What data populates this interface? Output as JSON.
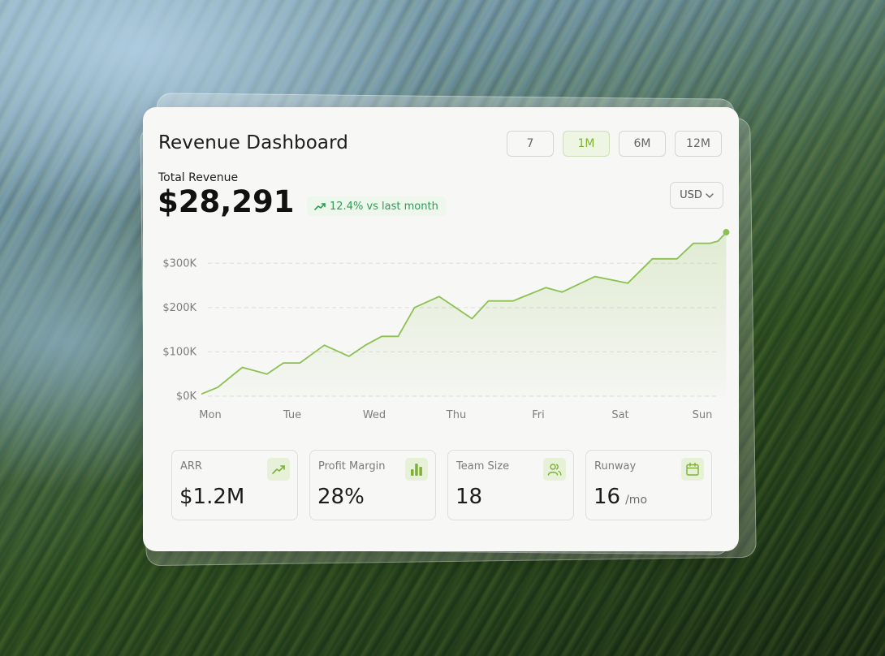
{
  "header": {
    "title": "Revenue Dashboard"
  },
  "ranges": [
    {
      "label": "7",
      "active": false
    },
    {
      "label": "1M",
      "active": true
    },
    {
      "label": "6M",
      "active": false
    },
    {
      "label": "12M",
      "active": false
    }
  ],
  "revenue": {
    "label": "Total Revenue",
    "value": "$28,291",
    "change": "12.4% vs last month"
  },
  "currency": {
    "selected": "USD"
  },
  "colors": {
    "accent": "#8cc152",
    "positive": "#2f9a57"
  },
  "chart_data": {
    "type": "area",
    "title": "",
    "xlabel": "",
    "ylabel": "",
    "categories": [
      "Mon",
      "Tue",
      "Wed",
      "Thu",
      "Fri",
      "Sat",
      "Sun"
    ],
    "y_ticks": [
      "$0K",
      "$100K",
      "$200K",
      "$300K"
    ],
    "ylim": [
      0,
      370
    ],
    "grid": true,
    "series": [
      {
        "x": [
          0,
          0.2,
          0.5,
          0.8,
          1.0,
          1.2,
          1.5,
          1.8,
          2.0,
          2.2,
          2.4,
          2.6,
          2.9,
          3.3,
          3.5,
          3.8,
          4.2,
          4.4,
          4.8,
          5.2,
          5.5,
          5.8,
          6.0,
          6.2,
          6.3,
          6.4
        ],
        "y": [
          5,
          20,
          65,
          50,
          75,
          75,
          115,
          90,
          115,
          135,
          135,
          200,
          225,
          175,
          215,
          215,
          245,
          235,
          270,
          255,
          310,
          310,
          345,
          345,
          350,
          370
        ]
      }
    ]
  },
  "stats": [
    {
      "label": "ARR",
      "value": "$1.2M",
      "unit": "",
      "icon": "trend-up-icon"
    },
    {
      "label": "Profit Margin",
      "value": "28%",
      "unit": "",
      "icon": "bar-chart-icon"
    },
    {
      "label": "Team Size",
      "value": "18",
      "unit": "",
      "icon": "users-icon"
    },
    {
      "label": "Runway",
      "value": "16",
      "unit": "/mo",
      "icon": "calendar-icon"
    }
  ]
}
